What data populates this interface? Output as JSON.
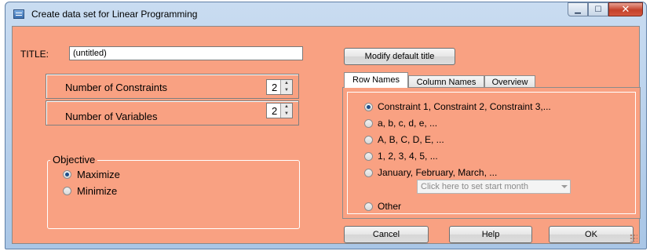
{
  "window": {
    "title": "Create data set for Linear Programming",
    "buttons": {
      "minimize_icon": "minimize-icon",
      "maximize_icon": "maximize-icon",
      "close_icon": "close-icon"
    }
  },
  "title_field": {
    "label": "TITLE:",
    "value": "(untitled)"
  },
  "modify_title_button": "Modify default title",
  "constraints": {
    "label": "Number of Constraints",
    "value": "2"
  },
  "variables": {
    "label": "Number of Variables",
    "value": "2"
  },
  "objective": {
    "legend": "Objective",
    "options": [
      {
        "label": "Maximize",
        "checked": true
      },
      {
        "label": "Minimize",
        "checked": false
      }
    ]
  },
  "tabs": [
    {
      "label": "Row Names",
      "active": true
    },
    {
      "label": "Column Names",
      "active": false
    },
    {
      "label": "Overview",
      "active": false
    }
  ],
  "row_name_options": [
    {
      "label": "Constraint 1, Constraint 2, Constraint 3,...",
      "checked": true
    },
    {
      "label": "a, b, c, d, e, ...",
      "checked": false
    },
    {
      "label": "A, B, C, D, E, ...",
      "checked": false
    },
    {
      "label": "1, 2, 3, 4, 5, ...",
      "checked": false
    },
    {
      "label": "January, February, March, ...",
      "checked": false
    },
    {
      "label": "Other",
      "checked": false
    }
  ],
  "start_month_combo": {
    "placeholder": "Click here to set start month"
  },
  "footer": {
    "cancel": "Cancel",
    "help": "Help",
    "ok": "OK"
  },
  "colors": {
    "client_background": "#f9a182",
    "window_frame": "#b7cfea",
    "close_button": "#c4412a"
  }
}
